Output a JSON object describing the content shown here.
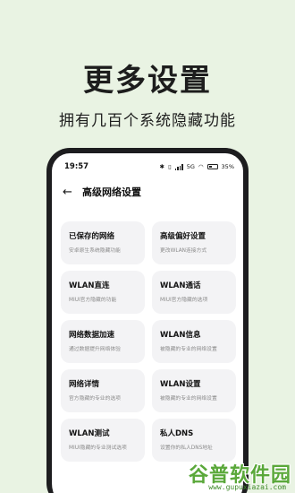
{
  "hero": {
    "title": "更多设置",
    "subtitle": "拥有几百个系统隐藏功能"
  },
  "status_bar": {
    "time": "19:57",
    "network": "5G",
    "battery": "35%"
  },
  "app_bar": {
    "title": "高级网络设置"
  },
  "cards": [
    {
      "title": "已保存的网络",
      "desc": "安卓原生系统隐藏功能"
    },
    {
      "title": "高级偏好设置",
      "desc": "更改WLAN连接方式"
    },
    {
      "title": "WLAN直连",
      "desc": "MIUI官方隐藏的功能"
    },
    {
      "title": "WLAN通话",
      "desc": "MIUI官方隐藏的选项"
    },
    {
      "title": "网络数据加速",
      "desc": "通过数据提升网络体验"
    },
    {
      "title": "WLAN信息",
      "desc": "被隐藏的专业的网络设置"
    },
    {
      "title": "网络详情",
      "desc": "官方隐藏的专业的选项"
    },
    {
      "title": "WLAN设置",
      "desc": "被隐藏的专业的网络设置"
    },
    {
      "title": "WLAN测试",
      "desc": "MIUI隐藏的专业测试选项"
    },
    {
      "title": "私人DNS",
      "desc": "设置你的私人DNS地址"
    }
  ],
  "watermark": {
    "text": "谷普软件园",
    "url": "www.gupuxiazai.com"
  }
}
